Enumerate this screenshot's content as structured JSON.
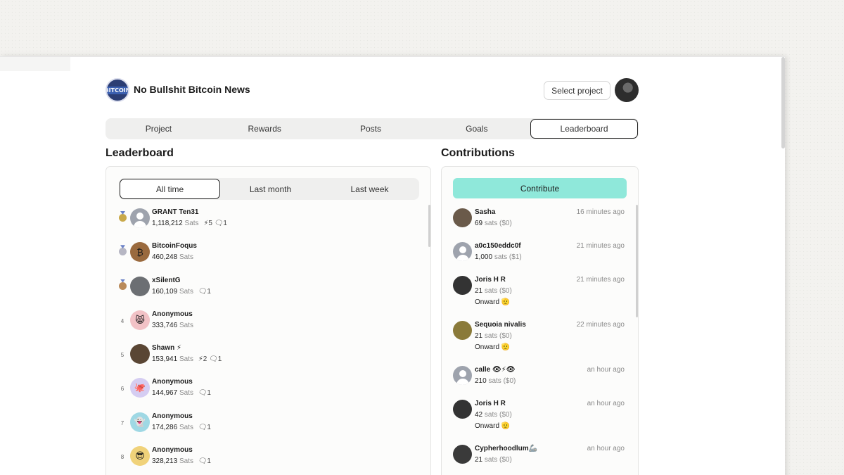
{
  "project": {
    "title": "No Bullshit Bitcoin News",
    "logo_text": "BITCOIN"
  },
  "header": {
    "select_project_label": "Select project"
  },
  "tabs": [
    {
      "label": "Project"
    },
    {
      "label": "Rewards"
    },
    {
      "label": "Posts"
    },
    {
      "label": "Goals"
    },
    {
      "label": "Leaderboard"
    }
  ],
  "leaderboard": {
    "title": "Leaderboard",
    "filters": [
      {
        "label": "All time"
      },
      {
        "label": "Last month"
      },
      {
        "label": "Last week"
      }
    ],
    "rows": [
      {
        "rank": "",
        "medal_color": "#c9a94a",
        "name": "GRANT Ten31",
        "amount": "1,118,212",
        "unit": "Sats",
        "extra": "⚡5  🗨1",
        "avatar": "",
        "avatar_bg": "#9ea3ad"
      },
      {
        "rank": "",
        "medal_color": "#b6b6c3",
        "name": "BitcoinFoqus",
        "amount": "460,248",
        "unit": "Sats",
        "extra": "",
        "avatar": "₿",
        "avatar_bg": "#9a6a3e"
      },
      {
        "rank": "",
        "medal_color": "#b98a5a",
        "name": "xSilentG",
        "amount": "160,109",
        "unit": "Sats",
        "extra": "🗨1",
        "avatar": "",
        "avatar_bg": "#6c6f73"
      },
      {
        "rank": "4",
        "medal_color": "",
        "name": "Anonymous",
        "amount": "333,746",
        "unit": "Sats",
        "extra": "",
        "avatar": "😸",
        "avatar_bg": "#f2c2c6"
      },
      {
        "rank": "5",
        "medal_color": "",
        "name": "Shawn ⚡",
        "amount": "153,941",
        "unit": "Sats",
        "extra": "⚡2  🗨1",
        "avatar": "",
        "avatar_bg": "#5a4634"
      },
      {
        "rank": "6",
        "medal_color": "",
        "name": "Anonymous",
        "amount": "144,967",
        "unit": "Sats",
        "extra": "🗨1",
        "avatar": "🐙",
        "avatar_bg": "#d5cdf2"
      },
      {
        "rank": "7",
        "medal_color": "",
        "name": "Anonymous",
        "amount": "174,286",
        "unit": "Sats",
        "extra": "🗨1",
        "avatar": "👻",
        "avatar_bg": "#9fd8e4"
      },
      {
        "rank": "8",
        "medal_color": "",
        "name": "Anonymous",
        "amount": "328,213",
        "unit": "Sats",
        "extra": "🗨1",
        "avatar": "😎",
        "avatar_bg": "#f0d27a"
      }
    ]
  },
  "contributions": {
    "title": "Contributions",
    "button_label": "Contribute",
    "rows": [
      {
        "name": "Sasha",
        "time": "16 minutes ago",
        "amount": "69",
        "unit": "sats ($0)",
        "message": "",
        "avatar_bg": "#6a5a4a"
      },
      {
        "name": "a0c150eddc0f",
        "time": "21 minutes ago",
        "amount": "1,000",
        "unit": "sats ($1)",
        "message": "",
        "avatar_bg": "#9ea3ad"
      },
      {
        "name": "Joris H R",
        "time": "21 minutes ago",
        "amount": "21",
        "unit": "sats ($0)",
        "message": "Onward 🫡",
        "avatar_bg": "#333333"
      },
      {
        "name": "Sequoia nivalis",
        "time": "22 minutes ago",
        "amount": "21",
        "unit": "sats ($0)",
        "message": "Onward 🫡",
        "avatar_bg": "#8a7a3a"
      },
      {
        "name": "calle 👁⚡👁",
        "time": "an hour ago",
        "amount": "210",
        "unit": "sats ($0)",
        "message": "",
        "avatar_bg": "#9ea3ad"
      },
      {
        "name": "Joris H R",
        "time": "an hour ago",
        "amount": "42",
        "unit": "sats ($0)",
        "message": "Onward 🫡",
        "avatar_bg": "#333333"
      },
      {
        "name": "Cypherhoodlum🦾",
        "time": "an hour ago",
        "amount": "21",
        "unit": "sats ($0)",
        "message": "",
        "avatar_bg": "#3a3a3a"
      }
    ]
  }
}
